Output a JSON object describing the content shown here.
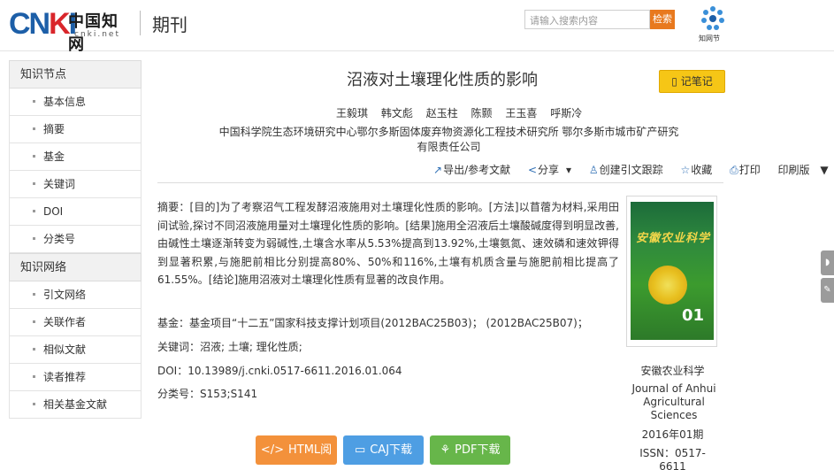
{
  "header": {
    "logo_cn": "中国知网",
    "logo_url": "cnki.net",
    "section": "期刊",
    "search_placeholder": "请输入搜索内容",
    "search_button": "检索",
    "zhiwangjie_label": "知网节"
  },
  "sidebar": {
    "groups": [
      {
        "title": "知识节点",
        "items": [
          "基本信息",
          "摘要",
          "基金",
          "关键词",
          "DOI",
          "分类号"
        ]
      },
      {
        "title": "知识网络",
        "items": [
          "引文网络",
          "关联作者",
          "相似文献",
          "读者推荐",
          "相关基金文献"
        ]
      }
    ]
  },
  "article": {
    "title": "沼液对土壤理化性质的影响",
    "note_button": "记笔记",
    "authors": [
      "王毅琪",
      "韩文彪",
      "赵玉柱",
      "陈颢",
      "王玉喜",
      "呼斯冷"
    ],
    "affiliation": "中国科学院生态环境研究中心鄂尔多斯固体废弃物资源化工程技术研究所 鄂尔多斯市城市矿产研究有限责任公司",
    "toolbar": {
      "export": "导出/参考文献",
      "share": "分享",
      "track": "创建引文跟踪",
      "favorite": "收藏",
      "print": "打印",
      "print_version": "印刷版"
    },
    "abstract": "摘要：[目的]为了考察沼气工程发酵沼液施用对土壤理化性质的影响。[方法]以苜蓿为材料,采用田间试验,探讨不同沼液施用量对土壤理化性质的影响。[结果]施用全沼液后土壤酸碱度得到明显改善,由碱性土壤逐渐转变为弱碱性,土壤含水率从5.53%提高到13.92%,土壤氨氮、速效磷和速效钾得到显著积累,与施肥前相比分别提高80%、50%和116%,土壤有机质含量与施肥前相比提高了61.55%。[结论]施用沼液对土壤理化性质有显著的改良作用。",
    "fund": "基金：基金项目“十二五”国家科技支撑计划项目(2012BAC25B03)； (2012BAC25B07)；",
    "keywords": "关键词：沼液; 土壤; 理化性质;",
    "doi": "DOI：10.13989/j.cnki.0517-6611.2016.01.064",
    "classification": "分类号：S153;S141"
  },
  "journal": {
    "cover_title": "安徽农业科学",
    "cover_issue": "01",
    "name_cn": "安徽农业科学",
    "name_en": "Journal of Anhui Agricultural Sciences",
    "date": "2016年01期",
    "issn": "ISSN：0517-6611"
  },
  "downloads": {
    "html": "HTML阅读",
    "caj": "CAJ下载",
    "pdf": "PDF下载"
  },
  "colors": {
    "logo_blue": "#1d5fa8",
    "search_orange": "#e8791e",
    "note_yellow": "#f6c616",
    "html_orange": "#f3913b",
    "caj_blue": "#4e9ee3",
    "pdf_green": "#67b64a"
  }
}
